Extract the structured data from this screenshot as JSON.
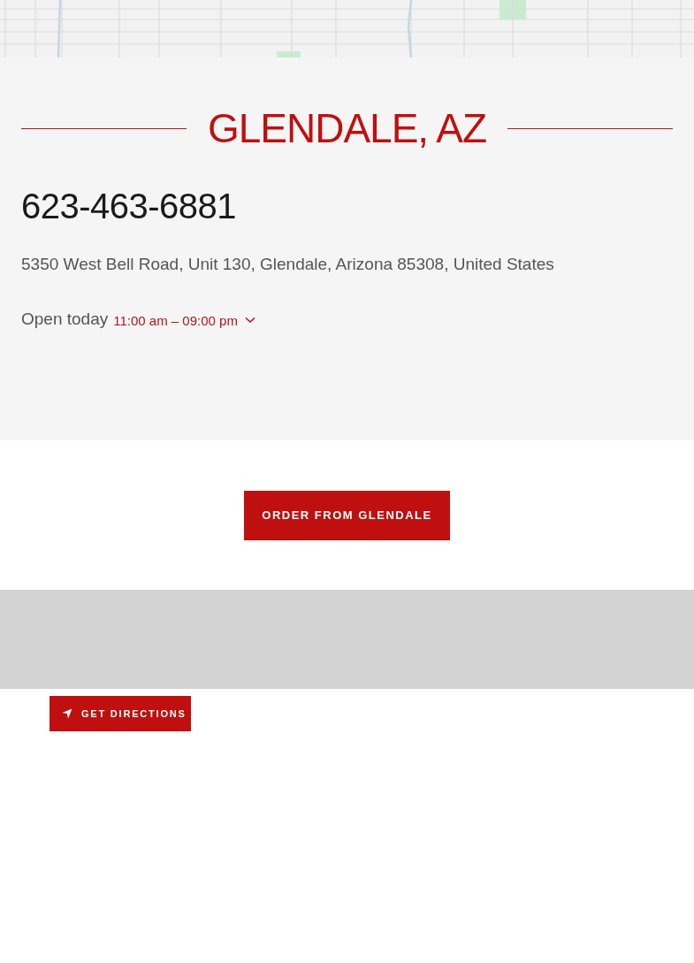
{
  "location": {
    "title": "GLENDALE, AZ",
    "phone": "623-463-6881",
    "address": "5350 West Bell Road, Unit 130, Glendale, Arizona 85308, United States",
    "hours_label": "Open today",
    "hours": "11:00 am – 09:00 pm",
    "hours_expanded": false
  },
  "order_button": "ORDER FROM GLENDALE",
  "directions_button": "GET DIRECTIONS"
}
